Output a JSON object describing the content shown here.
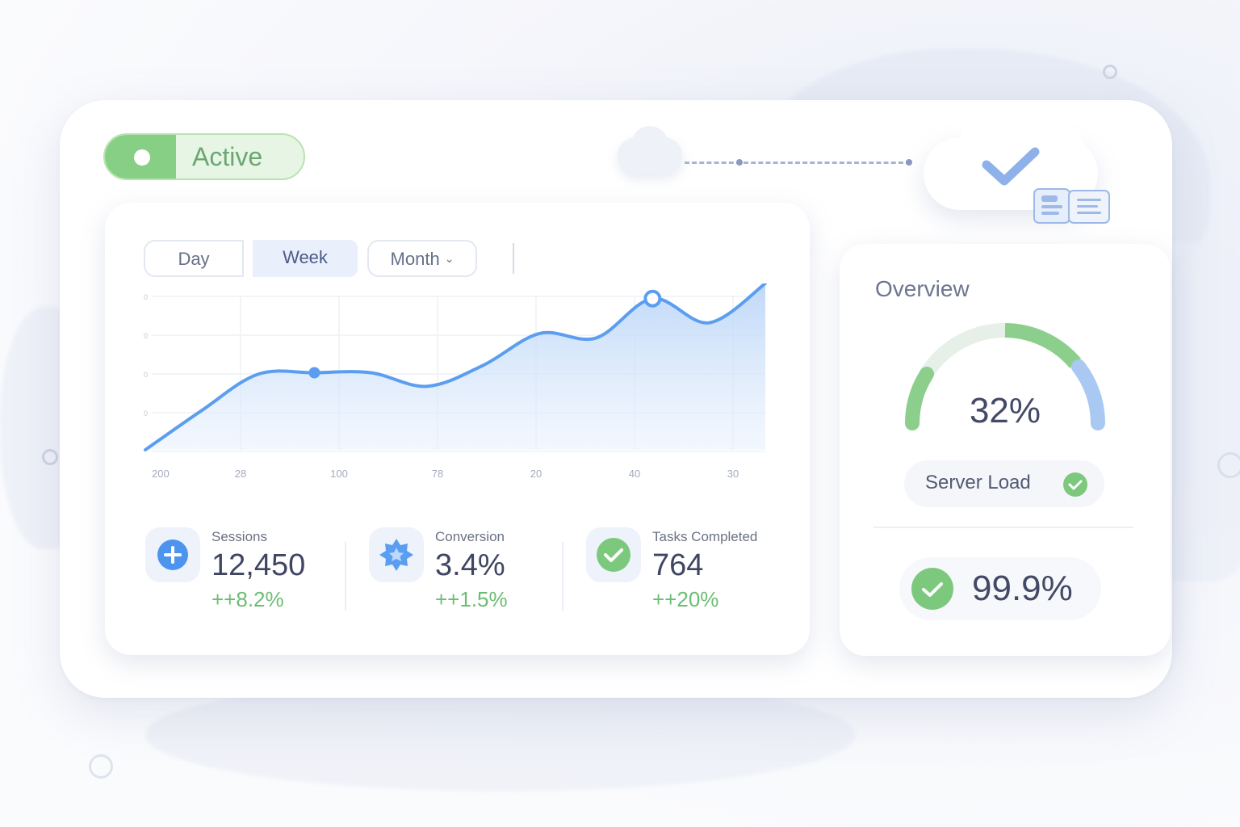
{
  "status_toggle": {
    "label": "Active",
    "on": true
  },
  "range_tabs": {
    "day": "Day",
    "week": "Week",
    "month": "Month",
    "selected": "Week"
  },
  "chart_data": {
    "type": "area",
    "x_tick_labels": [
      "200",
      "28",
      "100",
      "78",
      "20",
      "40",
      "30"
    ],
    "y_tick_labels": [
      "0",
      "0",
      "0",
      "0"
    ],
    "values": [
      0,
      26,
      50,
      51,
      51,
      42,
      56,
      77,
      74,
      100,
      84,
      110
    ],
    "ylim": [
      0,
      110
    ],
    "highlighted_points": [
      3,
      9
    ],
    "grid": true,
    "color": "#5b9ef0"
  },
  "stats": [
    {
      "label": "Sessions",
      "value": "12,450",
      "delta": "++8.2%",
      "icon": "plus-icon"
    },
    {
      "label": "Conversion",
      "value": "3.4%",
      "delta": "++1.5%",
      "icon": "star-badge-icon"
    },
    {
      "label": "Tasks Completed",
      "value": "764",
      "delta": "++20%",
      "icon": "check-circle-icon"
    }
  ],
  "overview": {
    "title": "Overview",
    "gauge_value": "32%",
    "gauge_percent": 32,
    "server_load_label": "Server Load",
    "uptime": "99.9%"
  },
  "colors": {
    "accent_blue": "#5b9ef0",
    "success_green": "#7dc97d",
    "gauge_track": "#e6efe8",
    "gauge_blue": "#a9c8f2"
  }
}
